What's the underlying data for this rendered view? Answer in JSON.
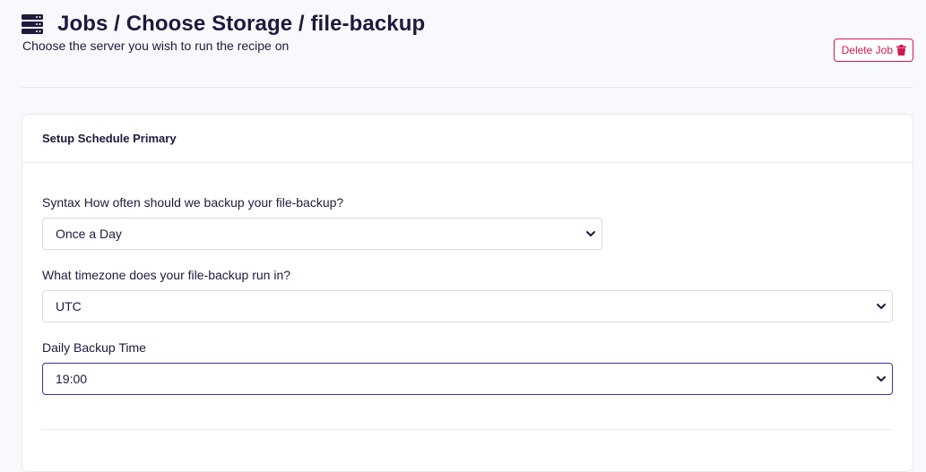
{
  "header": {
    "title": "Jobs / Choose Storage / file-backup",
    "subtitle": "Choose the server you wish to run the recipe on",
    "title_icon": "server-icon"
  },
  "actions": {
    "delete_label": "Delete Job",
    "delete_icon": "trash-icon",
    "delete_color": "#d1174f"
  },
  "card": {
    "title": "Setup Schedule Primary",
    "fields": [
      {
        "label": "Syntax How often should we backup your file-backup?",
        "value": "Once a Day"
      },
      {
        "label": "What timezone does your file-backup run in?",
        "value": "UTC"
      },
      {
        "label": "Daily Backup Time",
        "value": "19:00"
      }
    ]
  },
  "colors": {
    "text": "#1d1a3e",
    "focus_border": "#3b34a8",
    "background": "#f8f9fc"
  }
}
